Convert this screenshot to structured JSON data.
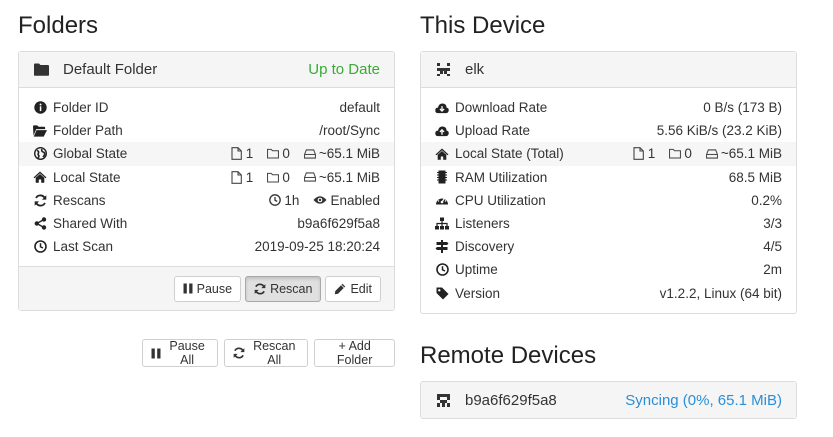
{
  "folders": {
    "title": "Folders",
    "panel": {
      "name": "Default Folder",
      "status": "Up to Date",
      "rows": [
        {
          "label": "Folder ID",
          "value": "default"
        },
        {
          "label": "Folder Path",
          "value": "/root/Sync"
        },
        {
          "label": "Global State",
          "files": "1",
          "dirs": "0",
          "size": "~65.1 MiB"
        },
        {
          "label": "Local State",
          "files": "1",
          "dirs": "0",
          "size": "~65.1 MiB"
        },
        {
          "label": "Rescans",
          "interval": "1h",
          "enabled": "Enabled"
        },
        {
          "label": "Shared With",
          "value": "b9a6f629f5a8"
        },
        {
          "label": "Last Scan",
          "value": "2019-09-25 18:20:24"
        }
      ],
      "buttons": {
        "pause": "Pause",
        "rescan": "Rescan",
        "edit": "Edit"
      }
    },
    "actions": {
      "pause_all": "Pause All",
      "rescan_all": "Rescan All",
      "add_folder": "+ Add Folder"
    }
  },
  "device": {
    "title": "This Device",
    "name": "elk",
    "rows": [
      {
        "label": "Download Rate",
        "value": "0 B/s (173 B)"
      },
      {
        "label": "Upload Rate",
        "value": "5.56 KiB/s (23.2 KiB)"
      },
      {
        "label": "Local State (Total)",
        "files": "1",
        "dirs": "0",
        "size": "~65.1 MiB"
      },
      {
        "label": "RAM Utilization",
        "value": "68.5 MiB"
      },
      {
        "label": "CPU Utilization",
        "value": "0.2%"
      },
      {
        "label": "Listeners",
        "value": "3/3"
      },
      {
        "label": "Discovery",
        "value": "4/5"
      },
      {
        "label": "Uptime",
        "value": "2m"
      },
      {
        "label": "Version",
        "value": "v1.2.2, Linux (64 bit)"
      }
    ]
  },
  "remote": {
    "title": "Remote Devices",
    "device": {
      "name": "b9a6f629f5a8",
      "status": "Syncing (0%, 65.1 MiB)"
    }
  },
  "colors": {
    "up_to_date": "#3aaa35",
    "syncing": "#2a8fd6",
    "listeners_ok": "#3aaa35"
  }
}
